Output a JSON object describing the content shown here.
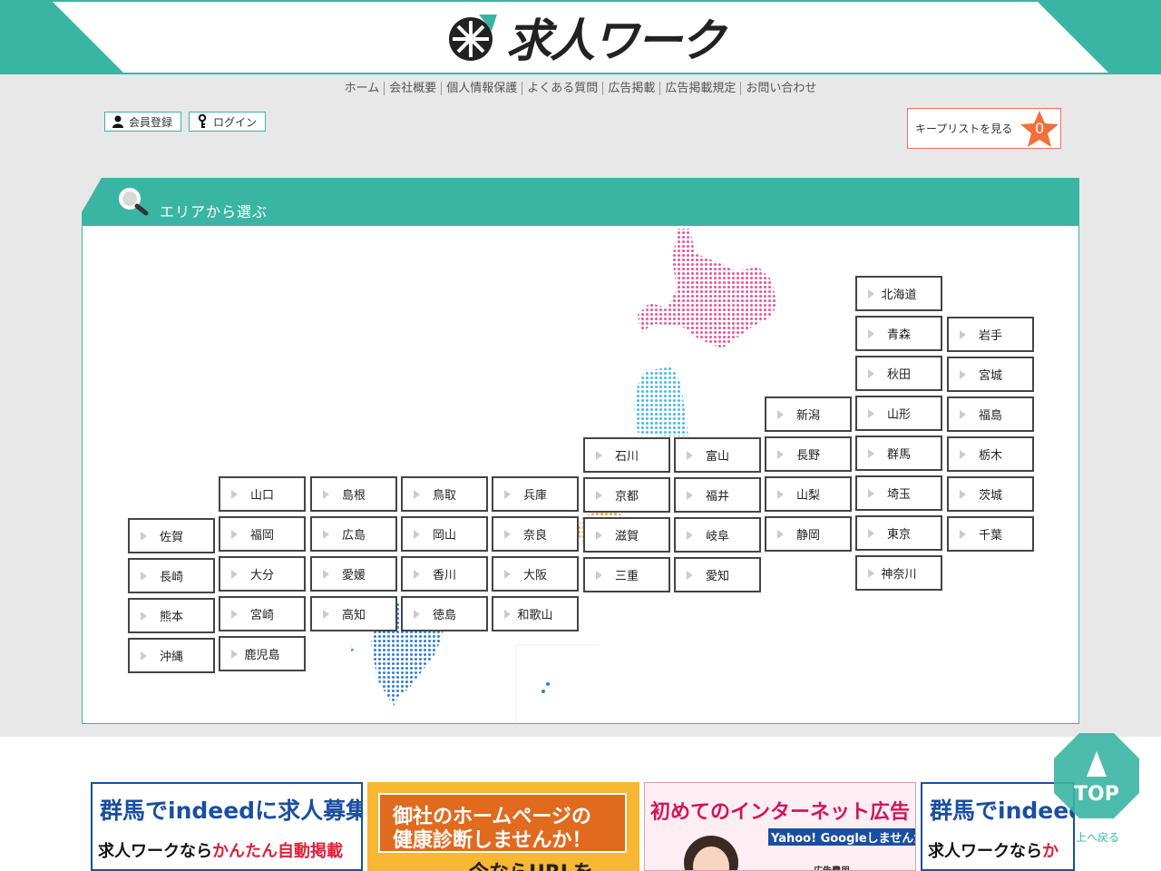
{
  "header": {
    "logo_text": "求人ワーク",
    "logo_icon": "asterisk-arrow-logo-icon"
  },
  "nav": [
    "ホーム",
    "会社概要",
    "個人情報保護",
    "よくある質問",
    "広告掲載",
    "広告掲載規定",
    "お問い合わせ"
  ],
  "member": {
    "register_label": "会員登録",
    "login_label": "ログイン"
  },
  "keeplist": {
    "label": "キープリストを見る",
    "count": "0"
  },
  "area": {
    "title": "エリアから選ぶ"
  },
  "prefectures": {
    "hokkaido": "北海道",
    "aomori": "青森",
    "iwate": "岩手",
    "akita": "秋田",
    "miyagi": "宮城",
    "niigata": "新潟",
    "yamagata": "山形",
    "fukushima": "福島",
    "ishikawa": "石川",
    "toyama": "富山",
    "nagano": "長野",
    "gunma": "群馬",
    "tochigi": "栃木",
    "yamaguchi": "山口",
    "shimane": "島根",
    "tottori": "鳥取",
    "hyogo": "兵庫",
    "kyoto": "京都",
    "fukui": "福井",
    "yamanashi": "山梨",
    "saitama": "埼玉",
    "ibaraki": "茨城",
    "saga": "佐賀",
    "fukuoka": "福岡",
    "hiroshima": "広島",
    "okayama": "岡山",
    "nara": "奈良",
    "shiga": "滋賀",
    "gifu": "岐阜",
    "shizuoka": "静岡",
    "tokyo": "東京",
    "chiba": "千葉",
    "nagasaki": "長崎",
    "oita": "大分",
    "ehime": "愛媛",
    "kagawa": "香川",
    "osaka": "大阪",
    "mie": "三重",
    "aichi": "愛知",
    "kanagawa": "神奈川",
    "kumamoto": "熊本",
    "miyazaki": "宮崎",
    "kochi": "高知",
    "tokushima": "徳島",
    "wakayama": "和歌山",
    "okinawa": "沖縄",
    "kagoshima": "鹿児島"
  },
  "banners": {
    "b1_line1": "群馬でindeedに求人募集",
    "b1_line2a": "求人ワークなら",
    "b1_line2b": "かんたん自動掲載",
    "b2_line1": "御社のホームページの",
    "b2_line2": "健康診断しませんか！",
    "b2_line3": "今ならURLを",
    "b3_title": "初めてのインターネット広告",
    "b3_sub": "Yahoo! Googleしませんか",
    "b3_small": "広告費用",
    "b4_line1": "群馬でindeed",
    "b4_line2a": "求人ワークなら",
    "b4_line2b": "か"
  },
  "top": {
    "label": "TOP",
    "back": "上へ戻る"
  },
  "colors": {
    "accent": "#3bb5a3",
    "hokkaido": "#e8559a",
    "tohoku": "#4db8e8",
    "kanto": "#f2a23a",
    "chubu": "#f0c23a",
    "kansai": "#f2a23a",
    "kyushu": "#2e7fd6"
  }
}
